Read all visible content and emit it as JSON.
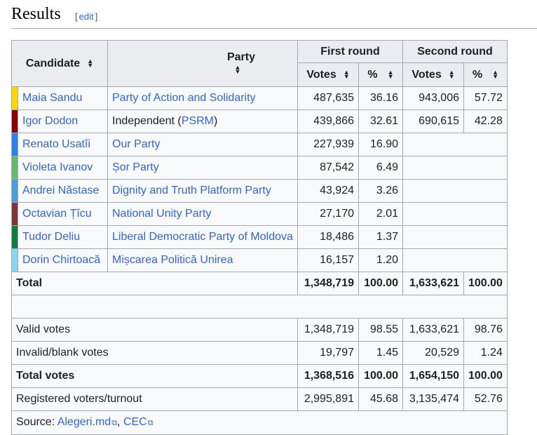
{
  "heading": {
    "title": "Results",
    "edit_label": "edit"
  },
  "table": {
    "headers": {
      "candidate": "Candidate",
      "party": "Party",
      "first_round": "First round",
      "second_round": "Second round",
      "votes": "Votes",
      "pct": "%"
    },
    "candidates": [
      {
        "name": "Maia Sandu",
        "party": "Party of Action and Solidarity",
        "color": "#FFD700",
        "v1": "487,635",
        "p1": "36.16",
        "v2": "943,006",
        "p2": "57.72"
      },
      {
        "name": "Igor Dodon",
        "party_prefix": "Independent (",
        "party_link": "PSRM",
        "party_suffix": ")",
        "color": "#8B0000",
        "v1": "439,866",
        "p1": "32.61",
        "v2": "690,615",
        "p2": "42.28"
      },
      {
        "name": "Renato Usatîi",
        "party": "Our Party",
        "color": "#2F7FF0",
        "v1": "227,939",
        "p1": "16.90"
      },
      {
        "name": "Violeta Ivanov",
        "party": "Șor Party",
        "color": "#66BB6A",
        "v1": "87,542",
        "p1": "6.49"
      },
      {
        "name": "Andrei Năstase",
        "party": "Dignity and Truth Platform Party",
        "color": "#4A9FD8",
        "v1": "43,924",
        "p1": "3.26"
      },
      {
        "name": "Octavian Țîcu",
        "party": "National Unity Party",
        "color": "#7F3535",
        "v1": "27,170",
        "p1": "2.01"
      },
      {
        "name": "Tudor Deliu",
        "party": "Liberal Democratic Party of Moldova",
        "color": "#0B7F3F",
        "v1": "18,486",
        "p1": "1.37"
      },
      {
        "name": "Dorin Chirtoacă",
        "party": "Mișcarea Politică Unirea",
        "color": "#87D4F5",
        "v1": "16,157",
        "p1": "1.20"
      }
    ],
    "total": {
      "label": "Total",
      "v1": "1,348,719",
      "p1": "100.00",
      "v2": "1,633,621",
      "p2": "100.00"
    },
    "valid": {
      "label": "Valid votes",
      "v1": "1,348,719",
      "p1": "98.55",
      "v2": "1,633,621",
      "p2": "98.76"
    },
    "invalid": {
      "label": "Invalid/blank votes",
      "v1": "19,797",
      "p1": "1.45",
      "v2": "20,529",
      "p2": "1.24"
    },
    "total_votes": {
      "label": "Total votes",
      "v1": "1,368,516",
      "p1": "100.00",
      "v2": "1,654,150",
      "p2": "100.00"
    },
    "registered": {
      "label": "Registered voters/turnout",
      "v1": "2,995,891",
      "p1": "45.68",
      "v2": "3,135,474",
      "p2": "52.76"
    },
    "source": {
      "prefix": "Source: ",
      "link1": "Alegeri.md",
      "sep": ", ",
      "link2": "CEC"
    }
  }
}
